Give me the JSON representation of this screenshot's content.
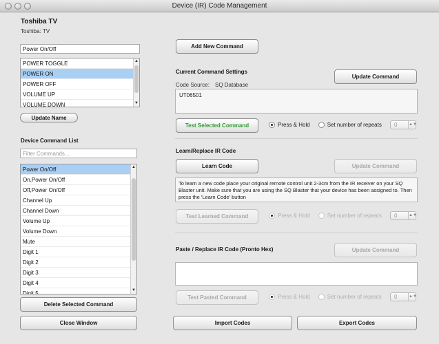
{
  "window": {
    "title": "Device (IR) Code Management"
  },
  "device": {
    "name": "Toshiba TV",
    "subtitle": "Toshiba: TV"
  },
  "command_name_input": {
    "value": "Power On/Off"
  },
  "command_names_list": {
    "items": [
      "POWER TOGGLE",
      "POWER ON",
      "POWER OFF",
      "VOLUME UP",
      "VOLUME DOWN"
    ],
    "selected_index": 1
  },
  "update_name_button": "Update Name",
  "device_command_list": {
    "heading": "Device Command List",
    "filter_placeholder": "Filter Commands...",
    "items": [
      "Power On/Off",
      "On,Power On/Off",
      "Off,Power On/Off",
      "Channel Up",
      "Channel Down",
      "Volume Up",
      "Volume Down",
      "Mute",
      "Digit 1",
      "Digit 2",
      "Digit 3",
      "Digit 4",
      "Digit 5"
    ],
    "selected_index": 0
  },
  "delete_selected_button": "Delete Selected Command",
  "close_window_button": "Close Window",
  "add_new_command_button": "Add New Command",
  "current_settings": {
    "heading": "Current Command Settings",
    "code_source_label": "Code Source:",
    "code_source_value": "SQ Database",
    "code_value": "UT06501",
    "update_button": "Update Command",
    "test_button": "Test Selected Command",
    "press_hold": "Press & Hold",
    "set_repeats": "Set number of repeats",
    "repeats_value": "0"
  },
  "learn": {
    "heading": "Learn/Replace IR Code",
    "learn_button": "Learn Code",
    "update_button": "Update Command",
    "instructions": "To learn a new code place your original remote control unit 2-3cm from the IR receiver on your SQ Blaster unit. Make sure that you are using the SQ Blaster that your device has been assigned to. Then press the 'Learn Code' button",
    "test_button": "Test Learned Command",
    "press_hold": "Press & Hold",
    "set_repeats": "Set number of repeats",
    "repeats_value": "0"
  },
  "paste": {
    "heading": "Paste / Replace IR Code (Pronto Hex)",
    "update_button": "Update Command",
    "text_value": "",
    "test_button": "Test Pasted Command",
    "press_hold": "Press & Hold",
    "set_repeats": "Set number of repeats",
    "repeats_value": "0"
  },
  "import_button": "Import Codes",
  "export_button": "Export Codes"
}
